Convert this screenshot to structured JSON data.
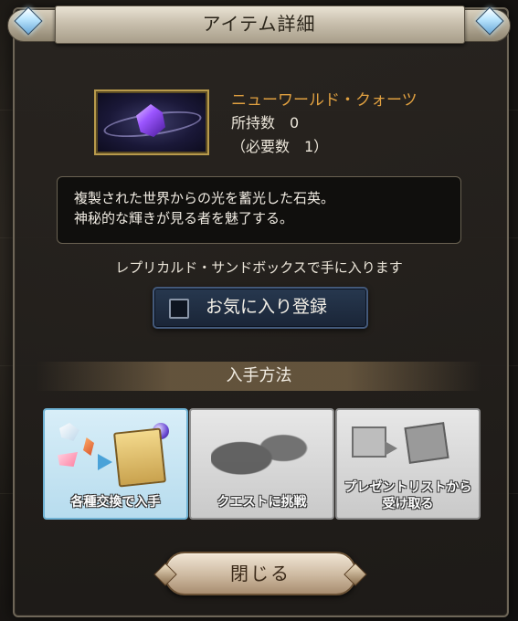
{
  "header": {
    "title": "アイテム詳細"
  },
  "item": {
    "name": "ニューワールド・クォーツ",
    "owned_text": "所持数　0",
    "required_text": "（必要数　1）",
    "description_line1": "複製された世界からの光を蓄光した石英。",
    "description_line2": "神秘的な輝きが見る者を魅了する。"
  },
  "obtain_text": "レプリカルド・サンドボックスで手に入ります",
  "favorite": {
    "label": "お気に入り登録",
    "checked": false
  },
  "acquisition": {
    "section_title": "入手方法",
    "methods": [
      {
        "label": "各種交換で入手",
        "active": true
      },
      {
        "label": "クエストに挑戦",
        "active": false
      },
      {
        "label_line1": "プレゼントリストから",
        "label_line2": "受け取る",
        "active": false
      }
    ]
  },
  "close_button": {
    "label": "閉じる"
  },
  "colors": {
    "item_name": "#e0a040",
    "active_method": "#b7dcee",
    "inactive_method": "#c9c9c9",
    "favorite_button": "#1a2537"
  }
}
